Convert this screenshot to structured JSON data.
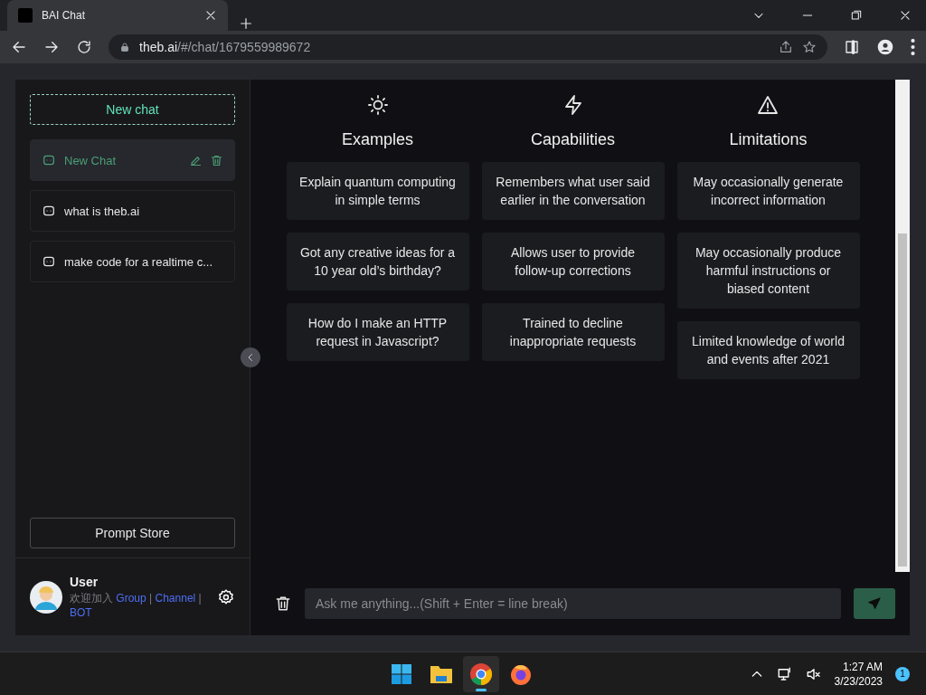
{
  "browser": {
    "tab_title": "BAI Chat",
    "url_host": "theb.ai",
    "url_path": "/#/chat/1679559989672"
  },
  "sidebar": {
    "new_chat": "New chat",
    "chats": [
      {
        "title": "New Chat",
        "selected": true
      },
      {
        "title": "what is theb.ai",
        "selected": false
      },
      {
        "title": "make code for a realtime c...",
        "selected": false
      }
    ],
    "prompt_store": "Prompt Store",
    "user": {
      "name": "User",
      "line": [
        {
          "kind": "text",
          "text": "欢迎加入"
        },
        {
          "kind": "link",
          "text": "Group"
        },
        {
          "kind": "text",
          "text": "|"
        },
        {
          "kind": "link",
          "text": "Channel"
        },
        {
          "kind": "text",
          "text": "|"
        },
        {
          "kind": "link",
          "text": "BOT"
        }
      ]
    }
  },
  "columns": [
    {
      "title": "Examples",
      "cards": [
        "Explain quantum computing in simple terms",
        "Got any creative ideas for a 10 year old’s birthday?",
        "How do I make an HTTP request in Javascript?"
      ]
    },
    {
      "title": "Capabilities",
      "cards": [
        "Remembers what user said earlier in the conversation",
        "Allows user to provide follow-up corrections",
        "Trained to decline inappropriate requests"
      ]
    },
    {
      "title": "Limitations",
      "cards": [
        "May occasionally generate incorrect information",
        "May occasionally produce harmful instructions or biased content",
        "Limited knowledge of world and events after 2021"
      ]
    }
  ],
  "input": {
    "placeholder": "Ask me anything...(Shift + Enter = line break)"
  },
  "taskbar": {
    "apps": [
      {
        "selected": false
      },
      {
        "selected": false
      },
      {
        "selected": true
      },
      {
        "selected": false
      }
    ],
    "time": "1:27 AM",
    "date": "3/23/2023",
    "notifications": "1"
  }
}
